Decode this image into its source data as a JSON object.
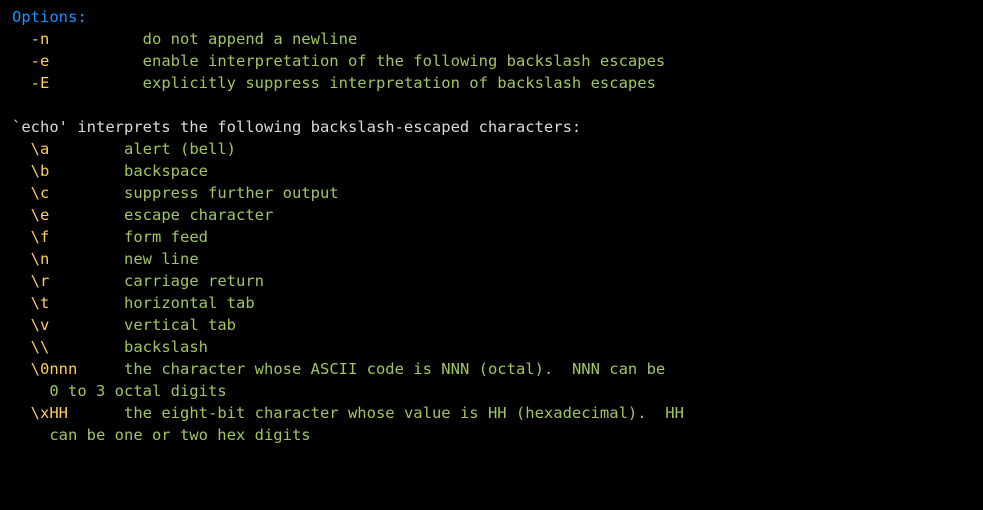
{
  "header": "Options:",
  "flags": [
    {
      "flag": "-n",
      "pad": "          ",
      "desc": "do not append a newline"
    },
    {
      "flag": "-e",
      "pad": "          ",
      "desc": "enable interpretation of the following backslash escapes"
    },
    {
      "flag": "-E",
      "pad": "          ",
      "desc": "explicitly suppress interpretation of backslash escapes"
    }
  ],
  "intro": "`echo' interprets the following backslash-escaped characters:",
  "escapes": [
    {
      "esc": "\\a",
      "pad": "        ",
      "desc": "alert (bell)",
      "wrap": ""
    },
    {
      "esc": "\\b",
      "pad": "        ",
      "desc": "backspace",
      "wrap": ""
    },
    {
      "esc": "\\c",
      "pad": "        ",
      "desc": "suppress further output",
      "wrap": ""
    },
    {
      "esc": "\\e",
      "pad": "        ",
      "desc": "escape character",
      "wrap": ""
    },
    {
      "esc": "\\f",
      "pad": "        ",
      "desc": "form feed",
      "wrap": ""
    },
    {
      "esc": "\\n",
      "pad": "        ",
      "desc": "new line",
      "wrap": ""
    },
    {
      "esc": "\\r",
      "pad": "        ",
      "desc": "carriage return",
      "wrap": ""
    },
    {
      "esc": "\\t",
      "pad": "        ",
      "desc": "horizontal tab",
      "wrap": ""
    },
    {
      "esc": "\\v",
      "pad": "        ",
      "desc": "vertical tab",
      "wrap": ""
    },
    {
      "esc": "\\\\",
      "pad": "        ",
      "desc": "backslash",
      "wrap": ""
    },
    {
      "esc": "\\0nnn",
      "pad": "     ",
      "desc": "the character whose ASCII code is NNN (octal).  NNN can be",
      "wrap": "    0 to 3 octal digits"
    },
    {
      "esc": "\\xHH",
      "pad": "      ",
      "desc": "the eight-bit character whose value is HH (hexadecimal).  HH",
      "wrap": "    can be one or two hex digits"
    }
  ]
}
